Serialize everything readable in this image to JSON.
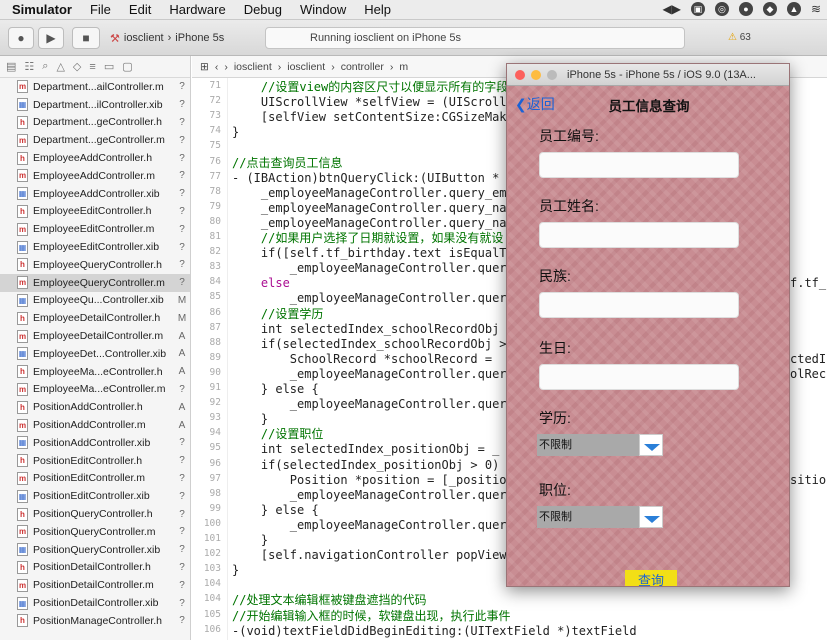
{
  "menubar": {
    "app": "Simulator",
    "items": [
      "File",
      "Edit",
      "Hardware",
      "Debug",
      "Window",
      "Help"
    ]
  },
  "toolbar": {
    "scheme_target": "iosclient",
    "scheme_device": "iPhone 5s",
    "activity": "Running iosclient on iPhone 5s",
    "warning_count": "63"
  },
  "jumpbar": {
    "items": [
      "iosclient",
      "iosclient",
      "controller",
      "m"
    ]
  },
  "navigator": {
    "files": [
      {
        "name": "Department...ailController.m",
        "status": "?",
        "kind": "m"
      },
      {
        "name": "Department...ilController.xib",
        "status": "?",
        "kind": "x"
      },
      {
        "name": "Department...geController.h",
        "status": "?",
        "kind": "h"
      },
      {
        "name": "Department...geController.m",
        "status": "?",
        "kind": "m"
      },
      {
        "name": "EmployeeAddController.h",
        "status": "?",
        "kind": "h"
      },
      {
        "name": "EmployeeAddController.m",
        "status": "?",
        "kind": "m"
      },
      {
        "name": "EmployeeAddController.xib",
        "status": "?",
        "kind": "x"
      },
      {
        "name": "EmployeeEditController.h",
        "status": "?",
        "kind": "h"
      },
      {
        "name": "EmployeeEditController.m",
        "status": "?",
        "kind": "m"
      },
      {
        "name": "EmployeeEditController.xib",
        "status": "?",
        "kind": "x"
      },
      {
        "name": "EmployeeQueryController.h",
        "status": "?",
        "kind": "h"
      },
      {
        "name": "EmployeeQueryController.m",
        "status": "?",
        "kind": "m",
        "selected": true
      },
      {
        "name": "EmployeeQu...Controller.xib",
        "status": "M",
        "kind": "x"
      },
      {
        "name": "EmployeeDetailController.h",
        "status": "M",
        "kind": "h"
      },
      {
        "name": "EmployeeDetailController.m",
        "status": "A",
        "kind": "m"
      },
      {
        "name": "EmployeeDet...Controller.xib",
        "status": "A",
        "kind": "x"
      },
      {
        "name": "EmployeeMa...eController.h",
        "status": "A",
        "kind": "h"
      },
      {
        "name": "EmployeeMa...eController.m",
        "status": "?",
        "kind": "m"
      },
      {
        "name": "PositionAddController.h",
        "status": "A",
        "kind": "h"
      },
      {
        "name": "PositionAddController.m",
        "status": "A",
        "kind": "m"
      },
      {
        "name": "PositionAddController.xib",
        "status": "?",
        "kind": "x"
      },
      {
        "name": "PositionEditController.h",
        "status": "?",
        "kind": "h"
      },
      {
        "name": "PositionEditController.m",
        "status": "?",
        "kind": "m"
      },
      {
        "name": "PositionEditController.xib",
        "status": "?",
        "kind": "x"
      },
      {
        "name": "PositionQueryController.h",
        "status": "?",
        "kind": "h"
      },
      {
        "name": "PositionQueryController.m",
        "status": "?",
        "kind": "m"
      },
      {
        "name": "PositionQueryController.xib",
        "status": "?",
        "kind": "x"
      },
      {
        "name": "PositionDetailController.h",
        "status": "?",
        "kind": "h"
      },
      {
        "name": "PositionDetailController.m",
        "status": "?",
        "kind": "m"
      },
      {
        "name": "PositionDetailController.xib",
        "status": "?",
        "kind": "x"
      },
      {
        "name": "PositionManageController.h",
        "status": "?",
        "kind": "h"
      }
    ]
  },
  "editor": {
    "lines": [
      {
        "n": "71",
        "t": "    //设置view的内容区尺寸以便显示所有的字段",
        "c": "cm"
      },
      {
        "n": "72",
        "t": "    UIScrollView *selfView = (UIScroll",
        "c": ""
      },
      {
        "n": "73",
        "t": "    [selfView setContentSize:CGSizeMak",
        "c": ""
      },
      {
        "n": "74",
        "t": "}",
        "c": ""
      },
      {
        "n": "75",
        "t": "",
        "c": ""
      },
      {
        "n": "76",
        "t": "//点击查询员工信息",
        "c": "cm"
      },
      {
        "n": "77",
        "t": "- (IBAction)btnQueryClick:(UIButton *",
        "c": ""
      },
      {
        "n": "78",
        "t": "    _employeeManageController.query_em",
        "c": ""
      },
      {
        "n": "79",
        "t": "    _employeeManageController.query_na",
        "c": ""
      },
      {
        "n": "80",
        "t": "    _employeeManageController.query_na",
        "c": ""
      },
      {
        "n": "81",
        "t": "    //如果用户选择了日期就设置，如果没有就设",
        "c": "cm"
      },
      {
        "n": "82",
        "t": "    if([self.tf_birthday.text isEqualT",
        "c": ""
      },
      {
        "n": "83",
        "t": "        _employeeManageController.quer",
        "c": ""
      },
      {
        "n": "84",
        "t": "    else",
        "c": "kw"
      },
      {
        "n": "85",
        "t": "        _employeeManageController.quer",
        "c": ""
      },
      {
        "n": "86",
        "t": "    //设置学历",
        "c": "cm"
      },
      {
        "n": "87",
        "t": "    int selectedIndex_schoolRecordObj",
        "c": ""
      },
      {
        "n": "88",
        "t": "    if(selectedIndex_schoolRecordObj >",
        "c": ""
      },
      {
        "n": "89",
        "t": "        SchoolRecord *schoolRecord =",
        "c": ""
      },
      {
        "n": "90",
        "t": "        _employeeManageController.quer",
        "c": ""
      },
      {
        "n": "91",
        "t": "    } else {",
        "c": ""
      },
      {
        "n": "92",
        "t": "        _employeeManageController.quer",
        "c": ""
      },
      {
        "n": "93",
        "t": "    }",
        "c": ""
      },
      {
        "n": "94",
        "t": "    //设置职位",
        "c": "cm"
      },
      {
        "n": "95",
        "t": "    int selectedIndex_positionObj = _",
        "c": ""
      },
      {
        "n": "96",
        "t": "    if(selectedIndex_positionObj > 0)",
        "c": ""
      },
      {
        "n": "97",
        "t": "        Position *position = [_positio",
        "c": ""
      },
      {
        "n": "98",
        "t": "        _employeeManageController.quer",
        "c": ""
      },
      {
        "n": "99",
        "t": "    } else {",
        "c": ""
      },
      {
        "n": "100",
        "t": "        _employeeManageController.quer",
        "c": ""
      },
      {
        "n": "101",
        "t": "    }",
        "c": ""
      },
      {
        "n": "102",
        "t": "    [self.navigationController popView",
        "c": ""
      },
      {
        "n": "103",
        "t": "}",
        "c": ""
      },
      {
        "n": "104",
        "t": "",
        "c": ""
      },
      {
        "n": "104",
        "t": "//处理文本编辑框被键盘遮挡的代码",
        "c": "cm"
      },
      {
        "n": "105",
        "t": "//开始编辑输入框的时候，软键盘出现，执行此事件",
        "c": "cm"
      },
      {
        "n": "106",
        "t": "-(void)textFieldDidBeginEditing:(UITextField *)textField",
        "c": ""
      }
    ],
    "overflow_right": [
      "f.tf_b",
      "ctedInc",
      "olRecc",
      "sitionO"
    ]
  },
  "simulator": {
    "title": "iPhone 5s - iPhone 5s / iOS 9.0 (13A...",
    "back_label": "返回",
    "nav_title": "员工信息查询",
    "labels": {
      "emp_no": "员工编号:",
      "emp_name": "员工姓名:",
      "nation": "民族:",
      "birthday": "生日:",
      "education": "学历:",
      "position": "职位:"
    },
    "education_value": "不限制",
    "position_value": "不限制",
    "query_button": "查询"
  }
}
